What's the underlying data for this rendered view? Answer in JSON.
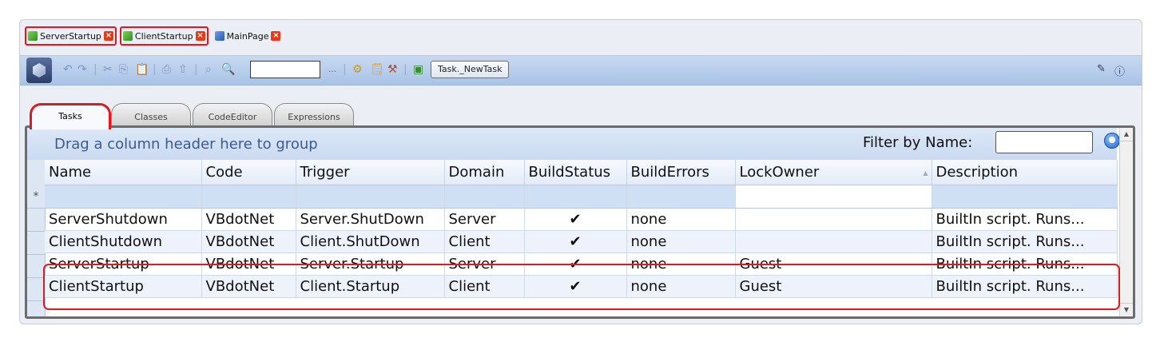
{
  "doc_tabs": [
    {
      "label": "ServerStartup",
      "icon": "green-grid-icon"
    },
    {
      "label": "ClientStartup",
      "icon": "green-grid-icon"
    },
    {
      "label": "MainPage",
      "icon": "computer-icon"
    }
  ],
  "toolbar": {
    "search_value": "",
    "ellipsis": "...",
    "new_task_label": "Task._NewTask"
  },
  "tabs": [
    {
      "label": "Tasks"
    },
    {
      "label": "Classes"
    },
    {
      "label": "CodeEditor"
    },
    {
      "label": "Expressions"
    }
  ],
  "grid": {
    "group_hint": "Drag a column header here to group",
    "filter_label": "Filter by Name:",
    "filter_value": "",
    "new_row_marker": "*",
    "columns": [
      "Name",
      "Code",
      "Trigger",
      "Domain",
      "BuildStatus",
      "BuildErrors",
      "LockOwner",
      "Description"
    ],
    "rows": [
      {
        "name": "ServerShutdown",
        "code": "VBdotNet",
        "trigger": "Server.ShutDown",
        "domain": "Server",
        "build_status": "✔",
        "build_errors": "none",
        "lock_owner": "",
        "description": "BuiltIn script. Runs..."
      },
      {
        "name": "ClientShutdown",
        "code": "VBdotNet",
        "trigger": "Client.ShutDown",
        "domain": "Client",
        "build_status": "✔",
        "build_errors": "none",
        "lock_owner": "",
        "description": "BuiltIn script. Runs..."
      },
      {
        "name": "ServerStartup",
        "code": "VBdotNet",
        "trigger": "Server.Startup",
        "domain": "Server",
        "build_status": "✔",
        "build_errors": "none",
        "lock_owner": "Guest",
        "description": "BuiltIn script. Runs..."
      },
      {
        "name": "ClientStartup",
        "code": "VBdotNet",
        "trigger": "Client.Startup",
        "domain": "Client",
        "build_status": "✔",
        "build_errors": "none",
        "lock_owner": "Guest",
        "description": "BuiltIn script. Runs..."
      }
    ]
  }
}
